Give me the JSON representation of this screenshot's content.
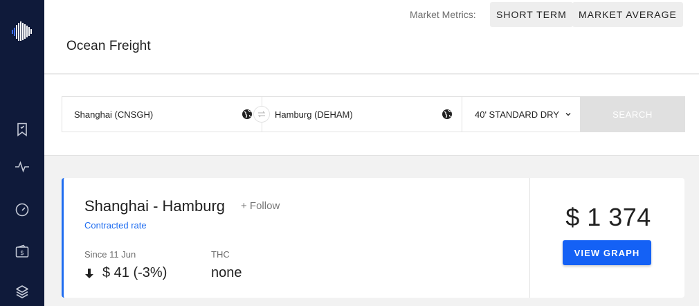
{
  "sidebar": {
    "logo": "barcode-logo-icon",
    "items": [
      {
        "icon": "bookmark-icon"
      },
      {
        "icon": "activity-pulse-icon"
      },
      {
        "icon": "gauge-icon"
      },
      {
        "icon": "wallet-dollar-icon"
      },
      {
        "icon": "layers-icon"
      }
    ]
  },
  "header": {
    "title": "Ocean Freight",
    "metrics_label": "Market Metrics:",
    "metric_buttons": [
      "SHORT TERM",
      "MARKET AVERAGE"
    ]
  },
  "search": {
    "origin": "Shanghai (CNSGH)",
    "destination": "Hamburg (DEHAM)",
    "container_type": "40' STANDARD DRY",
    "search_label": "SEARCH"
  },
  "result": {
    "route": "Shanghai - Hamburg",
    "follow_label": "+ Follow",
    "rate_type": "Contracted rate",
    "since_label": "Since 11 Jun",
    "change": "$ 41 (-3%)",
    "thc_label": "THC",
    "thc_value": "none",
    "price": "$ 1 374",
    "view_graph_label": "VIEW GRAPH"
  },
  "colors": {
    "sidebar_bg": "#0f1a3a",
    "accent_blue": "#1461f5",
    "link_blue": "#1e6cf0",
    "disabled_button": "#e0e0e0"
  }
}
